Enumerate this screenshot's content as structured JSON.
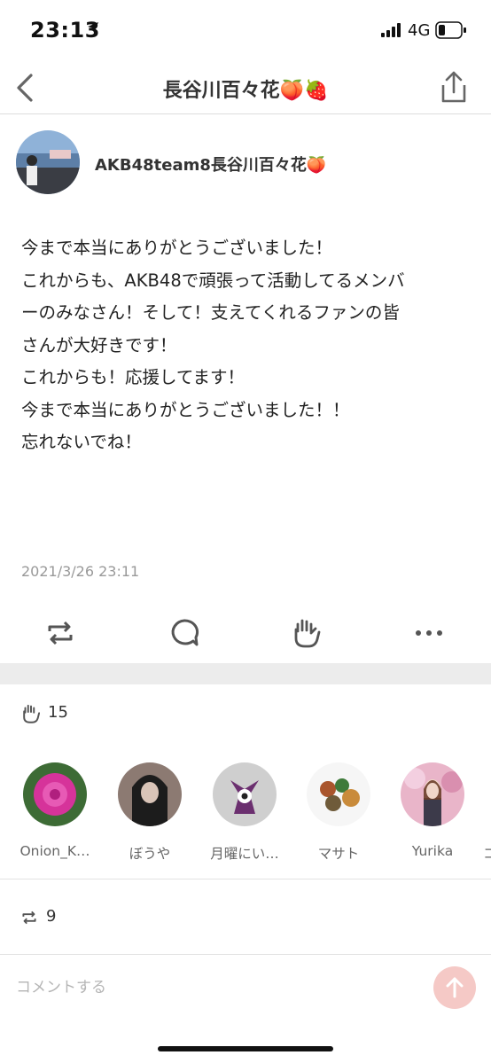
{
  "status_bar": {
    "time": "23:13",
    "network": "4G"
  },
  "nav": {
    "title": "長谷川百々花🍑🍓"
  },
  "post": {
    "author": "AKB48team8長谷川百々花🍑",
    "lines": [
      "今まで本当にありがとうございました！",
      "これからも、AKB48で頑張って活動してるメンバ",
      "ーのみなさん！そして！支えてくれるファンの皆",
      "さんが大好きです！",
      "これからも！応援してます！",
      "今まで本当にありがとうございました！！",
      "忘れないでね！"
    ],
    "timestamp": "2021/3/26 23:11"
  },
  "likes": {
    "count": "15",
    "users": [
      {
        "name": "Onion_K…"
      },
      {
        "name": "ぼうや"
      },
      {
        "name": "月曜にい…"
      },
      {
        "name": "マサト"
      },
      {
        "name": "Yurika"
      },
      {
        "name": "コ"
      }
    ]
  },
  "reposts": {
    "count": "9"
  },
  "comment": {
    "placeholder": "コメントする"
  },
  "colors": {
    "accent_send": "#f5c9c6",
    "separator": "#ececec",
    "icon": "#555555"
  }
}
